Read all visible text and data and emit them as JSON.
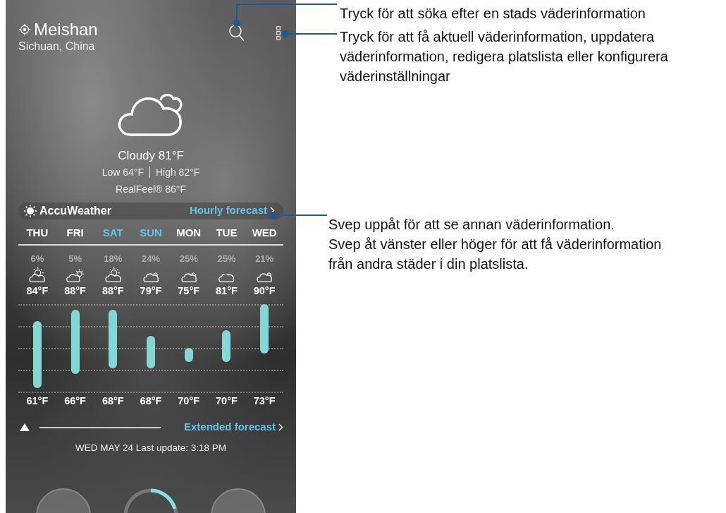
{
  "location": {
    "city": "Meishan",
    "region": "Sichuan, China"
  },
  "current": {
    "condition": "Cloudy",
    "temp": "81°F",
    "low": "Low 64°F",
    "high": "High 82°F",
    "realfeel": "RealFeel® 86°F"
  },
  "provider": "AccuWeather",
  "hourly_link": "Hourly forecast",
  "days": [
    {
      "day": "THU",
      "weekend": false,
      "precip": "6%",
      "kind": "partly-sunny",
      "high": "84°F",
      "low": "61°F"
    },
    {
      "day": "FRI",
      "weekend": false,
      "precip": "5%",
      "kind": "sun-right",
      "high": "88°F",
      "low": "66°F"
    },
    {
      "day": "SAT",
      "weekend": true,
      "precip": "18%",
      "kind": "partly-sunny",
      "high": "88°F",
      "low": "68°F"
    },
    {
      "day": "SUN",
      "weekend": true,
      "precip": "24%",
      "kind": "cloudy",
      "high": "79°F",
      "low": "68°F"
    },
    {
      "day": "MON",
      "weekend": false,
      "precip": "25%",
      "kind": "cloudy",
      "high": "75°F",
      "low": "70°F"
    },
    {
      "day": "TUE",
      "weekend": false,
      "precip": "25%",
      "kind": "cloud",
      "high": "81°F",
      "low": "70°F"
    },
    {
      "day": "WED",
      "weekend": false,
      "precip": "21%",
      "kind": "cloudy",
      "high": "90°F",
      "low": "73°F"
    }
  ],
  "extended_link": "Extended forecast",
  "updated": "WED MAY 24 Last update: 3:18 PM",
  "callouts": [
    {
      "text": "Tryck för att söka efter en stads väderinformation"
    },
    {
      "text": "Tryck för att få aktuell väderinformation, uppdatera väderinformation, redigera platslista eller konfigurera väderinställningar"
    },
    {
      "text": "Svep uppåt för att se annan väderinformation."
    },
    {
      "text": "Svep åt vänster eller höger för att få väderinformation från andra städer i din platslista."
    }
  ]
}
